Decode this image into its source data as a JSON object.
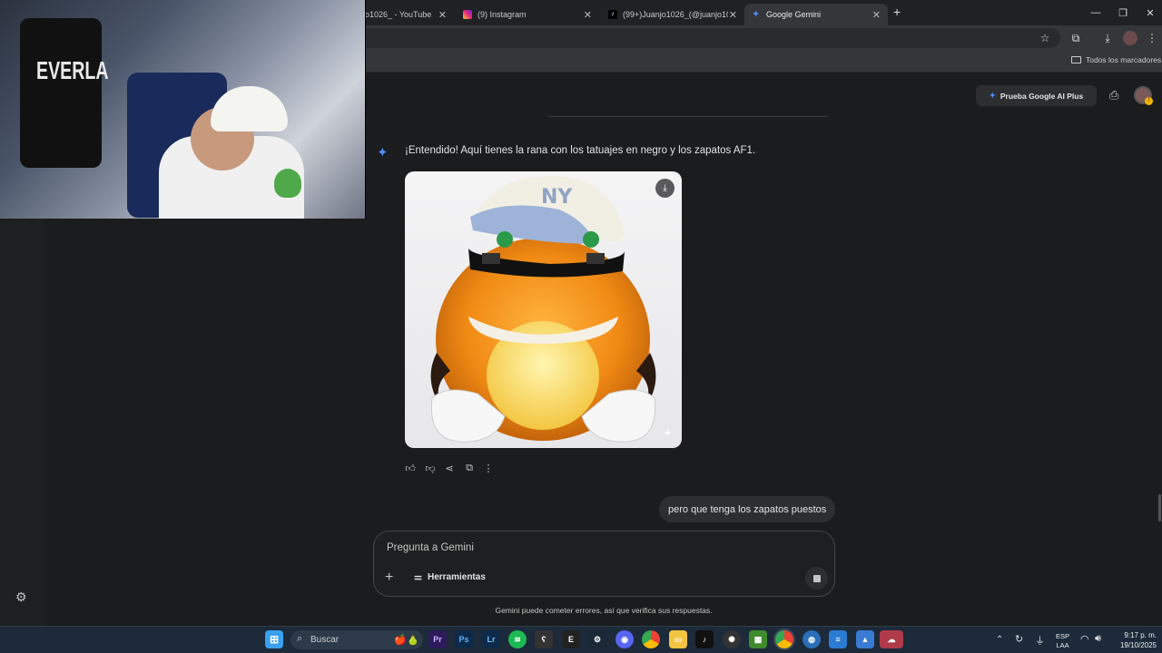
{
  "browser": {
    "tabs": [
      {
        "title": "jo1026_ - YouTube",
        "active": false
      },
      {
        "title": "(9) Instagram",
        "active": false
      },
      {
        "title": "(99+)Juanjo1026_(@juanjo102",
        "active": false
      },
      {
        "title": "Google Gemini",
        "active": true
      }
    ],
    "new_tab": "+",
    "bookmarks_label": "Todos los marcadores",
    "window_controls": {
      "minimize": "—",
      "restore": "❐",
      "close": "✕"
    }
  },
  "header": {
    "promo_label": "Prueba Google AI Plus"
  },
  "conversation": {
    "model_message": "¡Entendido! Aquí tienes la rana con los tatuajes en negro y los zapatos AF1.",
    "image_cap_logo": "NY",
    "user_message": "pero que tenga los zapatos puestos"
  },
  "input": {
    "placeholder": "Pregunta a Gemini",
    "tools_label": "Herramientas"
  },
  "disclaimer": "Gemini puede cometer errores, así que verifica sus respuestas.",
  "webcam": {
    "brand_text": "EVERLA"
  },
  "taskbar": {
    "search_label": "Buscar",
    "apps": [
      "Pr",
      "Ps",
      "Lr"
    ],
    "language": "ESP",
    "keyboard": "LAA",
    "time": "9:17 p. m.",
    "date": "19/10/2025"
  },
  "colors": {
    "accent_blue": "#4c8df6",
    "page_bg": "#1b1c1d",
    "tab_active": "#35363a"
  }
}
